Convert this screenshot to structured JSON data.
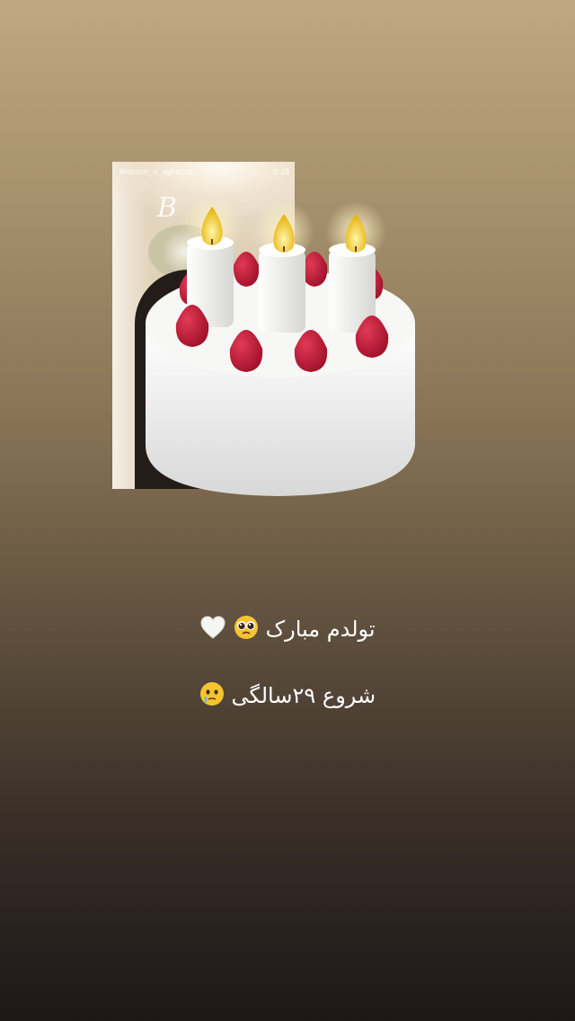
{
  "shared_post": {
    "username": "khanom_o_aghay.m",
    "time": "0:28",
    "script_text": "B"
  },
  "sticker": {
    "icon": "birthday-cake-icon"
  },
  "caption": {
    "line1_text": "تولدم مبارک",
    "line1_emojis": [
      "pleading-face-icon",
      "white-heart-icon"
    ],
    "line2_text": "شروع ۲۹سالگی",
    "line2_emojis": [
      "face-holding-back-tears-icon"
    ]
  }
}
